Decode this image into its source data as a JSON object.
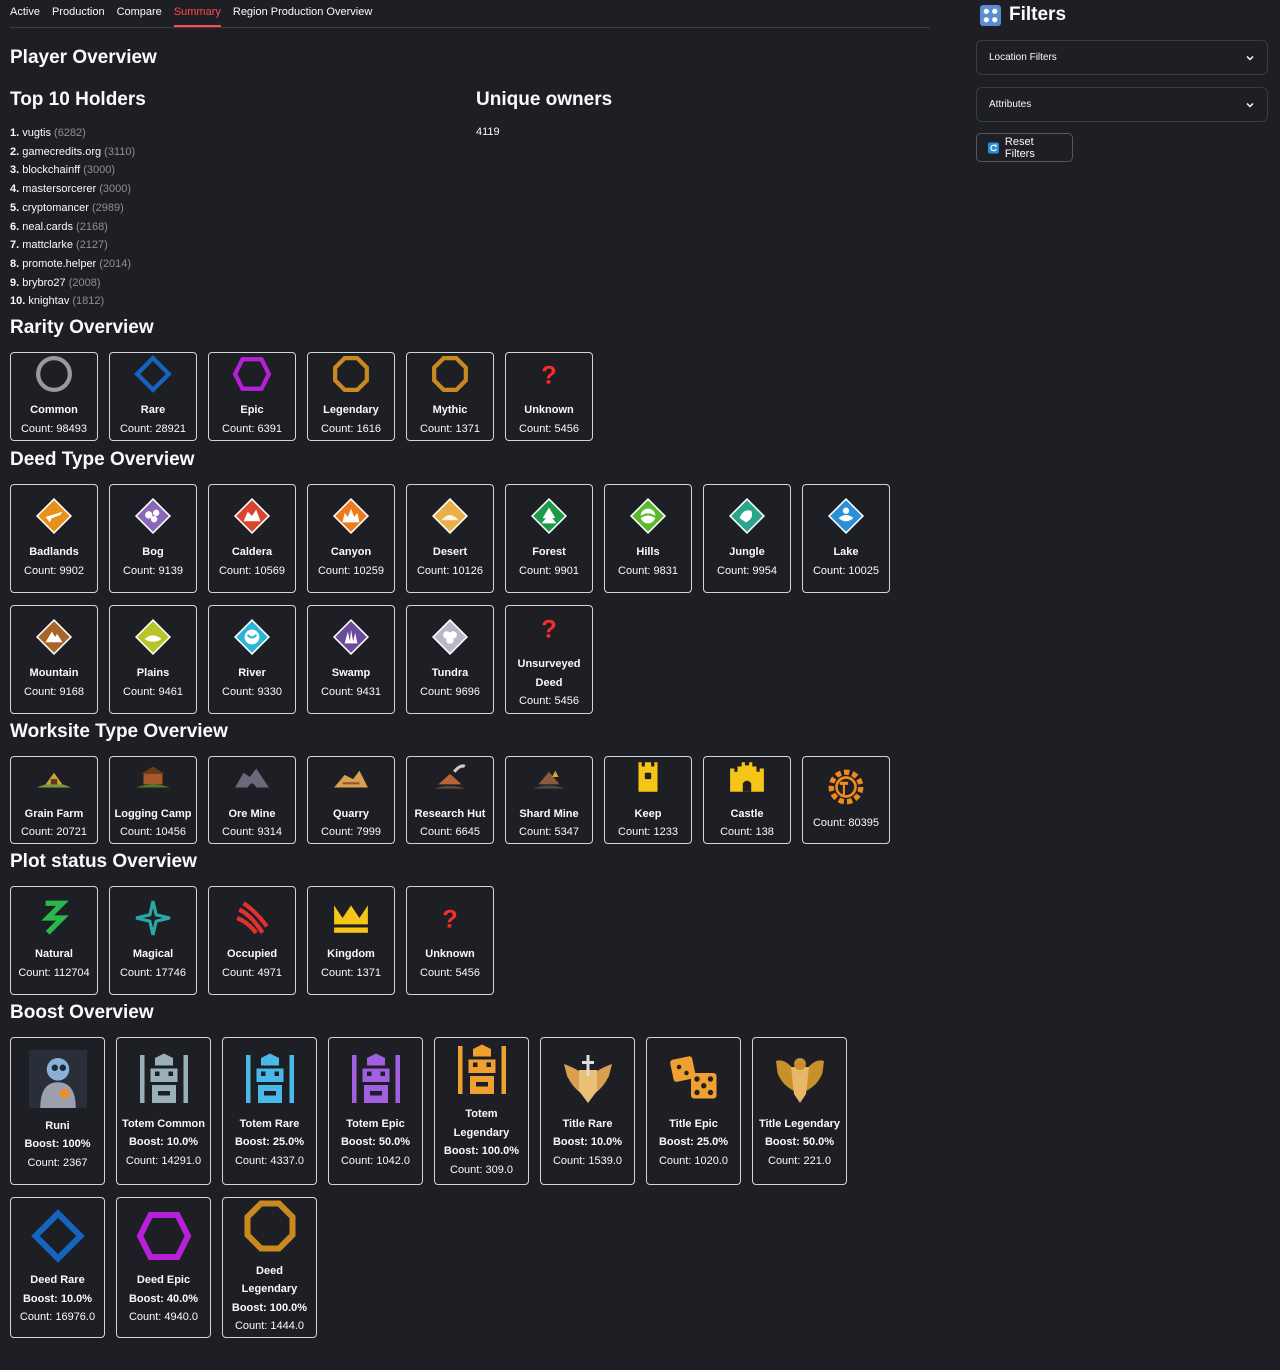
{
  "tabs": [
    "Active",
    "Production",
    "Compare",
    "Summary",
    "Region Production Overview"
  ],
  "active_tab": "Summary",
  "headings": {
    "player": "Player Overview",
    "top10": "Top 10 Holders",
    "unique": "Unique owners",
    "rarity": "Rarity Overview",
    "deed": "Deed Type Overview",
    "worksite": "Worksite Type Overview",
    "plot": "Plot status Overview",
    "boost": "Boost Overview"
  },
  "unique_owners": "4119",
  "holders": [
    {
      "rank": "1.",
      "name": "vugtis",
      "count": "(6282)"
    },
    {
      "rank": "2.",
      "name": "gamecredits.org",
      "count": "(3110)"
    },
    {
      "rank": "3.",
      "name": "blockchainff",
      "count": "(3000)"
    },
    {
      "rank": "4.",
      "name": "mastersorcerer",
      "count": "(3000)"
    },
    {
      "rank": "5.",
      "name": "cryptomancer",
      "count": "(2989)"
    },
    {
      "rank": "6.",
      "name": "neal.cards",
      "count": "(2168)"
    },
    {
      "rank": "7.",
      "name": "mattclarke",
      "count": "(2127)"
    },
    {
      "rank": "8.",
      "name": "promote.helper",
      "count": "(2014)"
    },
    {
      "rank": "9.",
      "name": "brybro27",
      "count": "(2008)"
    },
    {
      "rank": "10.",
      "name": "knightav",
      "count": "(1812)"
    }
  ],
  "rarity": [
    {
      "name": "Common",
      "count": "Count: 98493",
      "icon": "circle-icon",
      "color": "#9a9a9a"
    },
    {
      "name": "Rare",
      "count": "Count: 28921",
      "icon": "diamond-icon",
      "color": "#1565c0"
    },
    {
      "name": "Epic",
      "count": "Count: 6391",
      "icon": "hexagon-icon",
      "color": "#b620d8"
    },
    {
      "name": "Legendary",
      "count": "Count: 1616",
      "icon": "octagon-icon",
      "color": "#c88a1e"
    },
    {
      "name": "Mythic",
      "count": "Count: 1371",
      "icon": "octagon-icon",
      "color": "#c88a1e"
    },
    {
      "name": "Unknown",
      "count": "Count: 5456",
      "icon": "question-icon",
      "color": "#ff2b2b"
    }
  ],
  "deed_row1": [
    {
      "name": "Badlands",
      "count": "Count: 9902",
      "icon": "badlands-icon",
      "color": "#e8901e"
    },
    {
      "name": "Bog",
      "count": "Count: 9139",
      "icon": "bog-icon",
      "color": "#8a68b8"
    },
    {
      "name": "Caldera",
      "count": "Count: 10569",
      "icon": "caldera-icon",
      "color": "#d9452e"
    },
    {
      "name": "Canyon",
      "count": "Count: 10259",
      "icon": "canyon-icon",
      "color": "#ee7a1c"
    },
    {
      "name": "Desert",
      "count": "Count: 10126",
      "icon": "desert-icon",
      "color": "#e9b04a"
    },
    {
      "name": "Forest",
      "count": "Count: 9901",
      "icon": "forest-icon",
      "color": "#1f9a4a"
    },
    {
      "name": "Hills",
      "count": "Count: 9831",
      "icon": "hills-icon",
      "color": "#5cb82e"
    },
    {
      "name": "Jungle",
      "count": "Count: 9954",
      "icon": "jungle-icon",
      "color": "#2aa58a"
    },
    {
      "name": "Lake",
      "count": "Count: 10025",
      "icon": "lake-icon",
      "color": "#2a8ed8"
    }
  ],
  "deed_row2": [
    {
      "name": "Mountain",
      "count": "Count: 9168",
      "icon": "mountain-icon",
      "color": "#a8652a"
    },
    {
      "name": "Plains",
      "count": "Count: 9461",
      "icon": "plains-icon",
      "color": "#b9c42a"
    },
    {
      "name": "River",
      "count": "Count: 9330",
      "icon": "river-icon",
      "color": "#2ab6d8"
    },
    {
      "name": "Swamp",
      "count": "Count: 9431",
      "icon": "swamp-icon",
      "color": "#6a4c9c"
    },
    {
      "name": "Tundra",
      "count": "Count: 9696",
      "icon": "tundra-icon",
      "color": "#b8b8c8"
    },
    {
      "name": "Unsurveyed Deed",
      "count": "Count: 5456",
      "icon": "question-icon",
      "color": "#ff2b2b"
    }
  ],
  "worksite": [
    {
      "name": "Grain Farm",
      "count": "Count: 20721",
      "icon": "grain-farm-icon",
      "color": "#c9a23a"
    },
    {
      "name": "Logging Camp",
      "count": "Count: 10456",
      "icon": "logging-camp-icon",
      "color": "#a35a2a"
    },
    {
      "name": "Ore Mine",
      "count": "Count: 9314",
      "icon": "ore-mine-icon",
      "color": "#6a6a7a"
    },
    {
      "name": "Quarry",
      "count": "Count: 7999",
      "icon": "quarry-icon",
      "color": "#d8a050"
    },
    {
      "name": "Research Hut",
      "count": "Count: 6645",
      "icon": "research-hut-icon",
      "color": "#b8643a"
    },
    {
      "name": "Shard Mine",
      "count": "Count: 5347",
      "icon": "shard-mine-icon",
      "color": "#8a5a3a"
    },
    {
      "name": "Keep",
      "count": "Count: 1233",
      "icon": "keep-icon",
      "color": "#f5c518"
    },
    {
      "name": "Castle",
      "count": "Count: 138",
      "icon": "castle-icon",
      "color": "#f5c518"
    },
    {
      "name": "",
      "count": "Count: 80395",
      "icon": "gear-hammer-icon",
      "color": "#f08a1e"
    }
  ],
  "plot": [
    {
      "name": "Natural",
      "count": "Count: 112704",
      "icon": "natural-icon",
      "color": "#2ab84a"
    },
    {
      "name": "Magical",
      "count": "Count: 17746",
      "icon": "magical-icon",
      "color": "#2aa8a8"
    },
    {
      "name": "Occupied",
      "count": "Count: 4971",
      "icon": "claw-icon",
      "color": "#e03030"
    },
    {
      "name": "Kingdom",
      "count": "Count: 1371",
      "icon": "crown-icon",
      "color": "#f5c518"
    },
    {
      "name": "Unknown",
      "count": "Count: 5456",
      "icon": "question-icon",
      "color": "#ff2b2b"
    }
  ],
  "boost_row1": [
    {
      "name": "Runi",
      "boost": "Boost: 100%",
      "count": "Count: 2367",
      "icon": "runi-icon",
      "color": "#4a7ab8"
    },
    {
      "name": "Totem Common",
      "boost": "Boost: 10.0%",
      "count": "Count: 14291.0",
      "icon": "totem-icon",
      "color": "#9ab0b8"
    },
    {
      "name": "Totem Rare",
      "boost": "Boost: 25.0%",
      "count": "Count: 4337.0",
      "icon": "totem-icon",
      "color": "#4ab8e8"
    },
    {
      "name": "Totem Epic",
      "boost": "Boost: 50.0%",
      "count": "Count: 1042.0",
      "icon": "totem-icon",
      "color": "#a060e0"
    },
    {
      "name": "Totem Legendary",
      "boost": "Boost: 100.0%",
      "count": "Count: 309.0",
      "icon": "totem-icon",
      "color": "#f0a030"
    },
    {
      "name": "Title Rare",
      "boost": "Boost: 10.0%",
      "count": "Count: 1539.0",
      "icon": "title-rare-icon",
      "color": "#d8a050"
    },
    {
      "name": "Title Epic",
      "boost": "Boost: 25.0%",
      "count": "Count: 1020.0",
      "icon": "dice-icon",
      "color": "#f0a030"
    },
    {
      "name": "Title Legendary",
      "boost": "Boost: 50.0%",
      "count": "Count: 221.0",
      "icon": "title-legendary-icon",
      "color": "#c8902a"
    }
  ],
  "boost_row2": [
    {
      "name": "Deed Rare",
      "boost": "Boost: 10.0%",
      "count": "Count: 16976.0",
      "icon": "diamond-icon",
      "color": "#1565c0"
    },
    {
      "name": "Deed Epic",
      "boost": "Boost: 40.0%",
      "count": "Count: 4940.0",
      "icon": "hexagon-icon",
      "color": "#b620d8"
    },
    {
      "name": "Deed Legendary",
      "boost": "Boost: 100.0%",
      "count": "Count: 1444.0",
      "icon": "octagon-icon",
      "color": "#c88a1e"
    }
  ],
  "sidebar": {
    "title": "Filters",
    "location": "Location Filters",
    "attributes": "Attributes",
    "reset": "Reset Filters"
  }
}
